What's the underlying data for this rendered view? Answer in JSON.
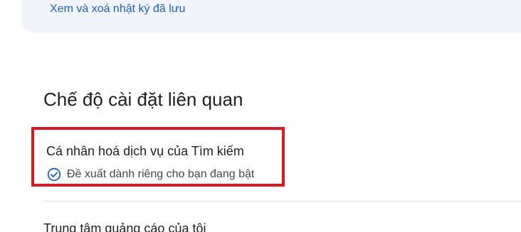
{
  "top": {
    "link_label": "Xem và xoá nhật ký đã lưu"
  },
  "related": {
    "title": "Chế độ cài đặt liên quan",
    "items": [
      {
        "title": "Cá nhân hoá dịch vụ của Tìm kiếm",
        "status": "Đề xuất dành riêng cho bạn đang bật",
        "status_icon": "check-circle-icon"
      },
      {
        "title": "Trung tâm quảng cáo của tôi"
      }
    ]
  },
  "colors": {
    "link": "#1a5fd6",
    "highlight_border": "#e0161e",
    "card_background": "#f1f4fb",
    "check_icon": "#1a5fd6"
  }
}
